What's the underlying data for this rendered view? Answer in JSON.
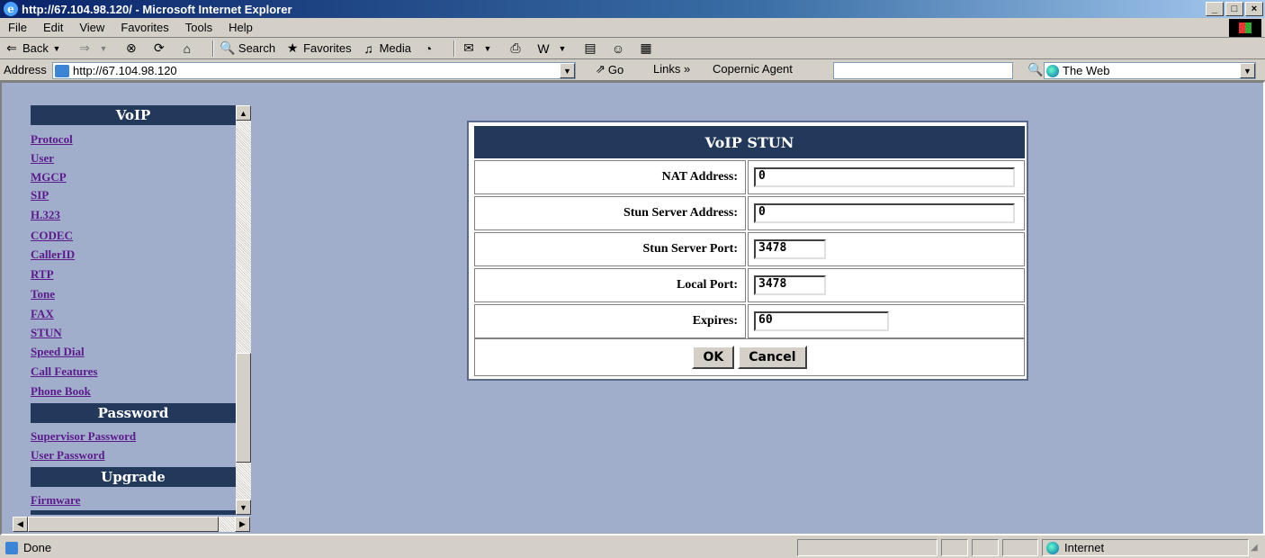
{
  "window": {
    "title": "http://67.104.98.120/ - Microsoft Internet Explorer",
    "min": "_",
    "max": "□",
    "close": "×"
  },
  "menu": [
    "File",
    "Edit",
    "View",
    "Favorites",
    "Tools",
    "Help"
  ],
  "toolbar": {
    "back": "Back",
    "search": "Search",
    "favorites": "Favorites",
    "media": "Media"
  },
  "address": {
    "label": "Address",
    "url": "http://67.104.98.120",
    "go": "Go",
    "links": "Links",
    "copernic": "Copernic Agent",
    "search_scope": "The Web"
  },
  "sidebar": {
    "sections": [
      {
        "title": "VoIP",
        "links": [
          "Protocol",
          "User",
          "MGCP",
          "SIP",
          "H.323",
          "CODEC",
          "CallerID",
          "RTP",
          "Tone",
          "FAX",
          "STUN",
          "Speed Dial",
          "Call Features",
          "Phone Book"
        ]
      },
      {
        "title": "Password",
        "links": [
          "Supervisor Password",
          "User Password"
        ]
      },
      {
        "title": "Upgrade",
        "links": [
          "Firmware"
        ]
      }
    ]
  },
  "form": {
    "title": "VoIP STUN",
    "fields": [
      {
        "label": "NAT Address:",
        "value": "0"
      },
      {
        "label": "Stun Server Address:",
        "value": "0"
      },
      {
        "label": "Stun Server Port:",
        "value": "3478"
      },
      {
        "label": "Local Port:",
        "value": "3478"
      },
      {
        "label": "Expires:",
        "value": "60"
      }
    ],
    "ok": "OK",
    "cancel": "Cancel"
  },
  "status": {
    "text": "Done",
    "zone": "Internet"
  },
  "colors": {
    "page_bg": "#a0aecb",
    "header_bg": "#23395b",
    "link": "#5c1a8c"
  }
}
